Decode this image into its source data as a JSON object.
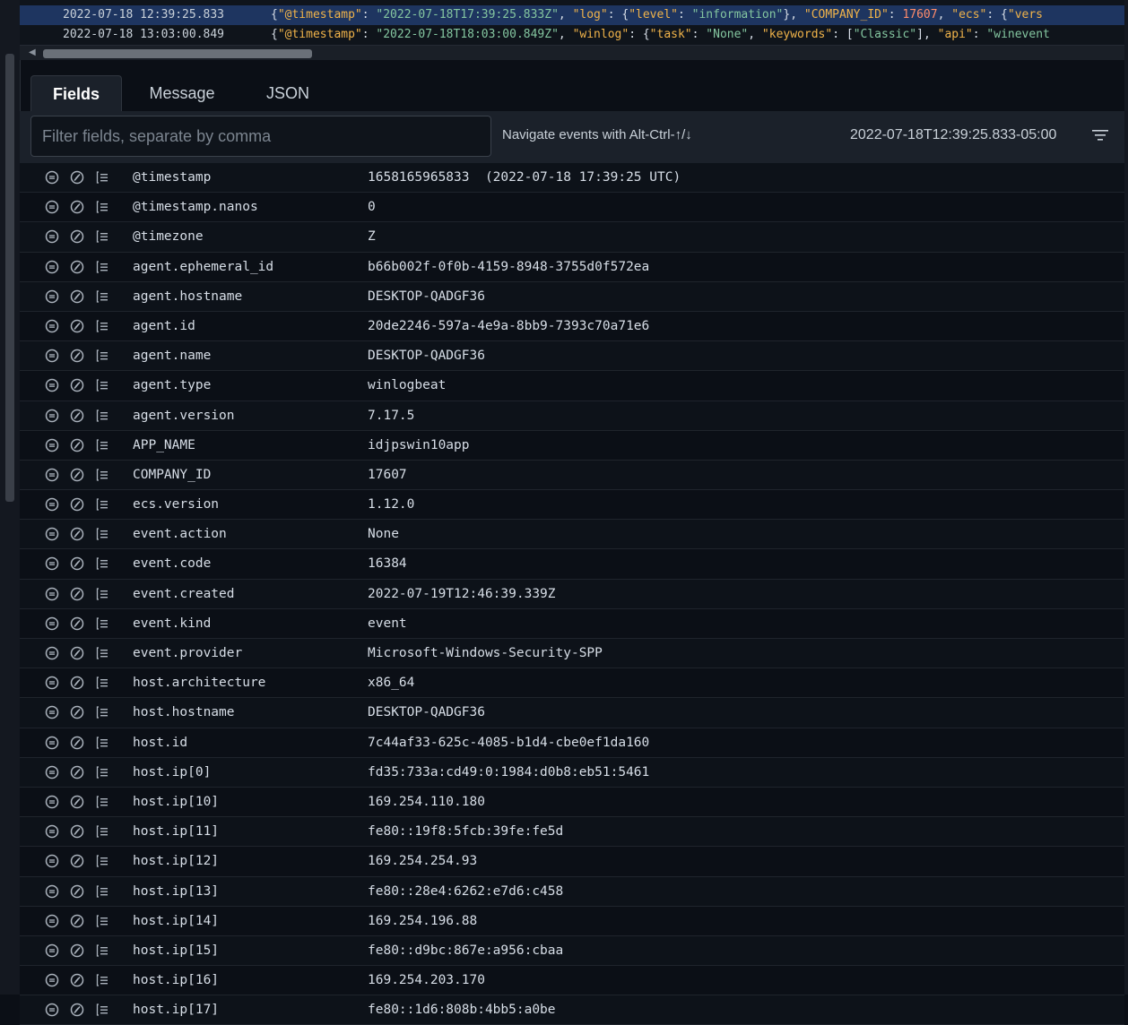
{
  "log_rows": [
    {
      "timestamp": "2022-07-18 12:39:25.833",
      "selected": true,
      "segments": [
        {
          "t": "{",
          "c": "p"
        },
        {
          "t": "\"@timestamp\"",
          "c": "k"
        },
        {
          "t": ": ",
          "c": "p"
        },
        {
          "t": "\"2022-07-18T17:39:25.833Z\"",
          "c": "s"
        },
        {
          "t": ", ",
          "c": "p"
        },
        {
          "t": "\"log\"",
          "c": "k"
        },
        {
          "t": ": {",
          "c": "p"
        },
        {
          "t": "\"level\"",
          "c": "k"
        },
        {
          "t": ": ",
          "c": "p"
        },
        {
          "t": "\"information\"",
          "c": "s"
        },
        {
          "t": "}, ",
          "c": "p"
        },
        {
          "t": "\"COMPANY_ID\"",
          "c": "k"
        },
        {
          "t": ": ",
          "c": "p"
        },
        {
          "t": "17607",
          "c": "n"
        },
        {
          "t": ", ",
          "c": "p"
        },
        {
          "t": "\"ecs\"",
          "c": "k"
        },
        {
          "t": ": {",
          "c": "p"
        },
        {
          "t": "\"vers",
          "c": "k"
        }
      ]
    },
    {
      "timestamp": "2022-07-18 13:03:00.849",
      "selected": false,
      "segments": [
        {
          "t": "{",
          "c": "p"
        },
        {
          "t": "\"@timestamp\"",
          "c": "k"
        },
        {
          "t": ": ",
          "c": "p"
        },
        {
          "t": "\"2022-07-18T18:03:00.849Z\"",
          "c": "s"
        },
        {
          "t": ", ",
          "c": "p"
        },
        {
          "t": "\"winlog\"",
          "c": "k"
        },
        {
          "t": ": {",
          "c": "p"
        },
        {
          "t": "\"task\"",
          "c": "k"
        },
        {
          "t": ": ",
          "c": "p"
        },
        {
          "t": "\"None\"",
          "c": "s"
        },
        {
          "t": ", ",
          "c": "p"
        },
        {
          "t": "\"keywords\"",
          "c": "k"
        },
        {
          "t": ": [",
          "c": "p"
        },
        {
          "t": "\"Classic\"",
          "c": "s"
        },
        {
          "t": "], ",
          "c": "p"
        },
        {
          "t": "\"api\"",
          "c": "k"
        },
        {
          "t": ": ",
          "c": "p"
        },
        {
          "t": "\"winevent",
          "c": "s"
        }
      ]
    }
  ],
  "tabs": [
    {
      "label": "Fields",
      "active": true
    },
    {
      "label": "Message",
      "active": false
    },
    {
      "label": "JSON",
      "active": false
    }
  ],
  "toolbar": {
    "filter_placeholder": "Filter fields, separate by comma",
    "nav_hint": "Navigate events with Alt-Ctrl-↑/↓",
    "timestamp": "2022-07-18T12:39:25.833-05:00"
  },
  "icons": {
    "row_icon_1": "filter-in-icon",
    "row_icon_2": "filter-out-icon",
    "row_icon_3": "toggle-column-icon",
    "menu": "menu-icon"
  },
  "colors": {
    "key": "#f0b34a",
    "string": "#84c6a0",
    "number": "#ff8c6b",
    "selected_row": "#1e3560"
  },
  "fields": [
    {
      "name": "@timestamp",
      "value": "1658165965833  (2022-07-18 17:39:25 UTC)"
    },
    {
      "name": "@timestamp.nanos",
      "value": "0"
    },
    {
      "name": "@timezone",
      "value": "Z"
    },
    {
      "name": "agent.ephemeral_id",
      "value": "b66b002f-0f0b-4159-8948-3755d0f572ea"
    },
    {
      "name": "agent.hostname",
      "value": "DESKTOP-QADGF36"
    },
    {
      "name": "agent.id",
      "value": "20de2246-597a-4e9a-8bb9-7393c70a71e6"
    },
    {
      "name": "agent.name",
      "value": "DESKTOP-QADGF36"
    },
    {
      "name": "agent.type",
      "value": "winlogbeat"
    },
    {
      "name": "agent.version",
      "value": "7.17.5"
    },
    {
      "name": "APP_NAME",
      "value": "idjpswin10app"
    },
    {
      "name": "COMPANY_ID",
      "value": "17607"
    },
    {
      "name": "ecs.version",
      "value": "1.12.0"
    },
    {
      "name": "event.action",
      "value": "None"
    },
    {
      "name": "event.code",
      "value": "16384"
    },
    {
      "name": "event.created",
      "value": "2022-07-19T12:46:39.339Z"
    },
    {
      "name": "event.kind",
      "value": "event"
    },
    {
      "name": "event.provider",
      "value": "Microsoft-Windows-Security-SPP"
    },
    {
      "name": "host.architecture",
      "value": "x86_64"
    },
    {
      "name": "host.hostname",
      "value": "DESKTOP-QADGF36"
    },
    {
      "name": "host.id",
      "value": "7c44af33-625c-4085-b1d4-cbe0ef1da160"
    },
    {
      "name": "host.ip[0]",
      "value": "fd35:733a:cd49:0:1984:d0b8:eb51:5461"
    },
    {
      "name": "host.ip[10]",
      "value": "169.254.110.180"
    },
    {
      "name": "host.ip[11]",
      "value": "fe80::19f8:5fcb:39fe:fe5d"
    },
    {
      "name": "host.ip[12]",
      "value": "169.254.254.93"
    },
    {
      "name": "host.ip[13]",
      "value": "fe80::28e4:6262:e7d6:c458"
    },
    {
      "name": "host.ip[14]",
      "value": "169.254.196.88"
    },
    {
      "name": "host.ip[15]",
      "value": "fe80::d9bc:867e:a956:cbaa"
    },
    {
      "name": "host.ip[16]",
      "value": "169.254.203.170"
    },
    {
      "name": "host.ip[17]",
      "value": "fe80::1d6:808b:4bb5:a0be"
    }
  ]
}
